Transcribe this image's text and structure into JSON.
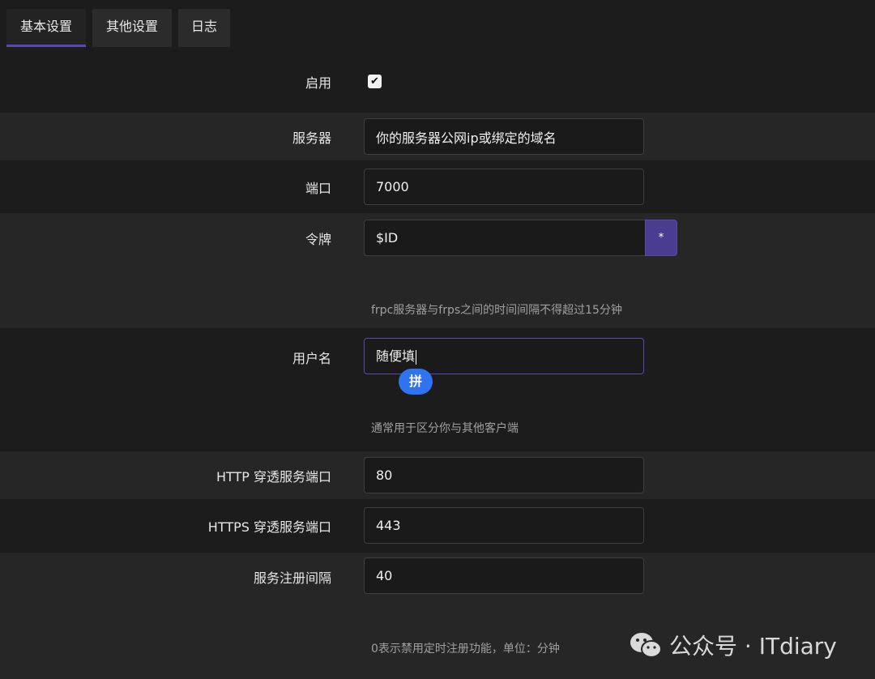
{
  "tabs": [
    {
      "label": "基本设置",
      "active": true
    },
    {
      "label": "其他设置",
      "active": false
    },
    {
      "label": "日志",
      "active": false
    }
  ],
  "form": {
    "enable": {
      "label": "启用",
      "checked": true
    },
    "server": {
      "label": "服务器",
      "value": "你的服务器公网ip或绑定的域名"
    },
    "port": {
      "label": "端口",
      "value": "7000"
    },
    "token": {
      "label": "令牌",
      "value": "$ID",
      "reveal_label": "*",
      "hint": "frpc服务器与frps之间的时间间隔不得超过15分钟"
    },
    "username": {
      "label": "用户名",
      "value": "随便填",
      "hint": "通常用于区分你与其他客户端",
      "ime_label": "拼"
    },
    "http_port": {
      "label": "HTTP 穿透服务端口",
      "value": "80"
    },
    "https_port": {
      "label": "HTTPS 穿透服务端口",
      "value": "443"
    },
    "register_interval": {
      "label": "服务注册间隔",
      "value": "40",
      "hint": "0表示禁用定时注册功能，单位：分钟"
    }
  },
  "watermark": {
    "text": "公众号 · ITdiary"
  },
  "colors": {
    "accent": "#5b45b0",
    "reveal_button": "#4a3d8f",
    "ime_pill": "#2f73f0",
    "row_light": "#262626",
    "row_dark": "#1c1c1c"
  }
}
